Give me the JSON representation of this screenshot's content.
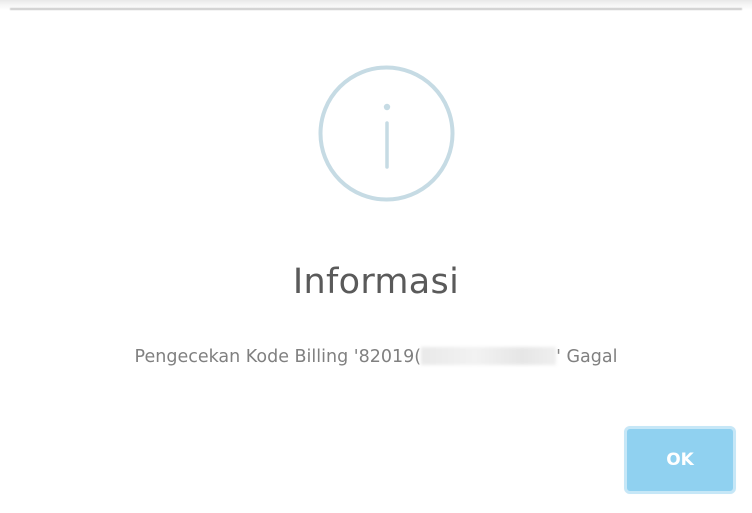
{
  "dialog": {
    "icon": "info-circle-icon",
    "title": "Informasi",
    "message_prefix": "Pengecekan Kode Billing '82019(",
    "message_suffix": "' Gagal",
    "ok_label": "OK"
  },
  "colors": {
    "icon_stroke": "#c6dbe4",
    "title_text": "#5a5a5a",
    "message_text": "#808080",
    "ok_button_bg": "#90d1f0",
    "ok_button_border": "#c6e7f7"
  }
}
